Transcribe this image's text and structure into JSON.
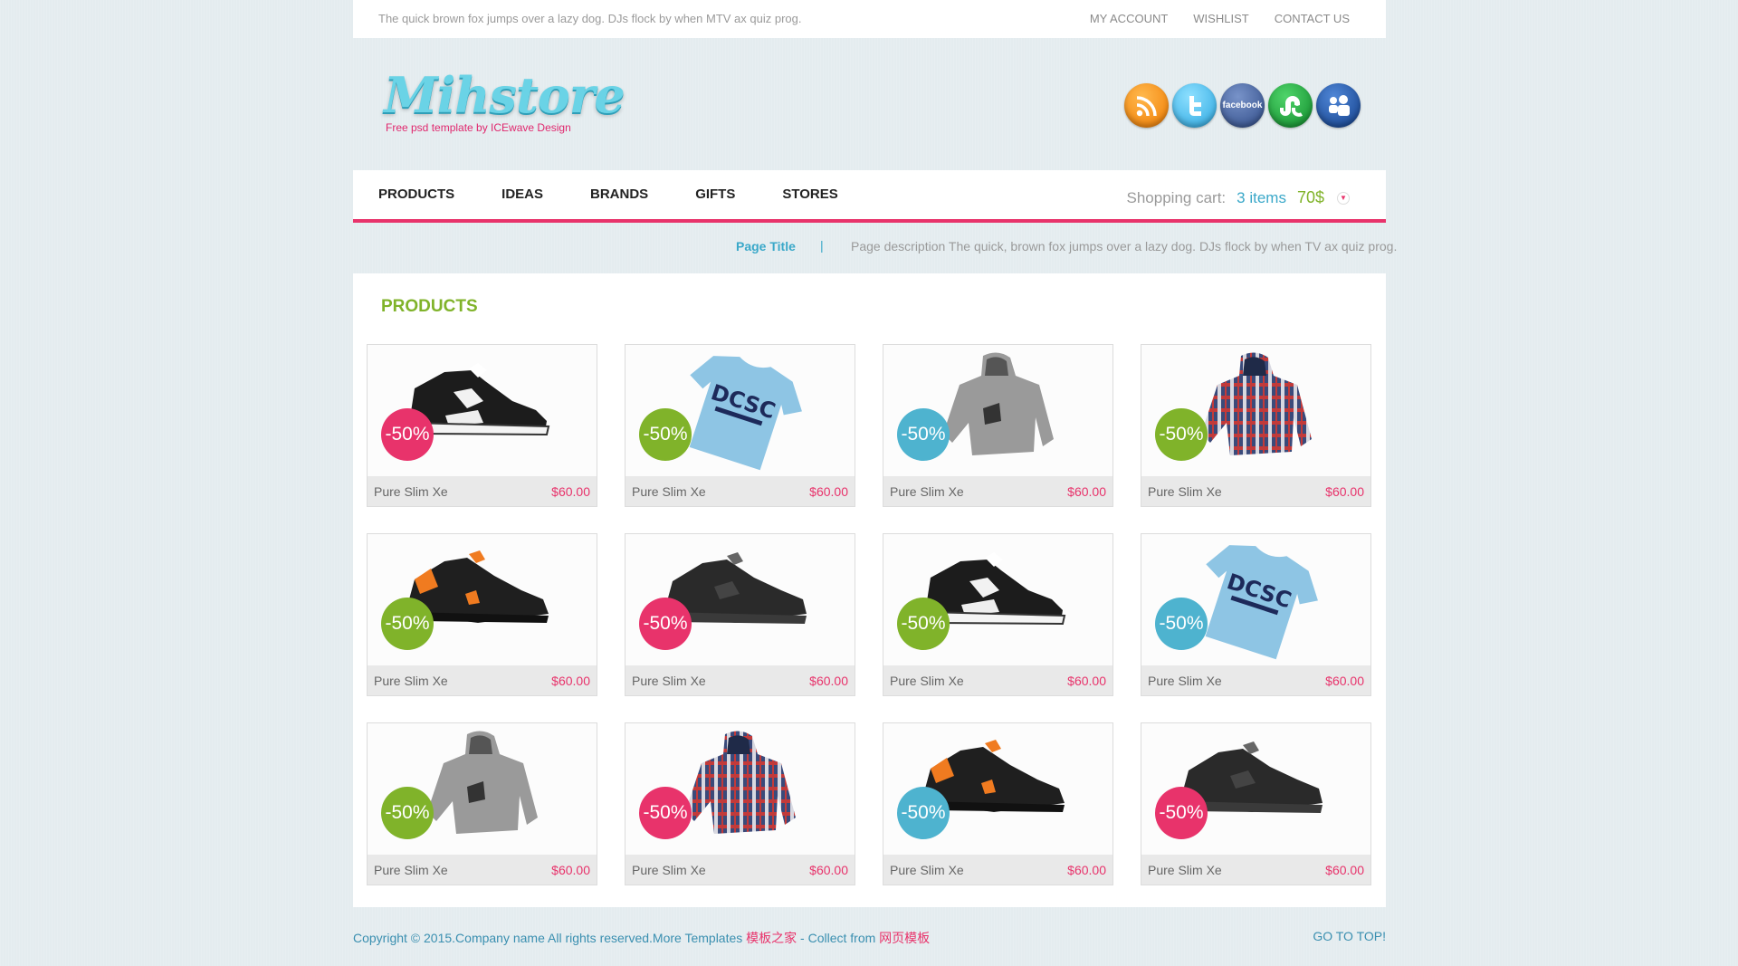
{
  "topbar": {
    "tagline": "The quick brown fox jumps over a lazy dog. DJs flock by when MTV ax quiz prog.",
    "links": [
      "MY ACCOUNT",
      "WISHLIST",
      "CONTACT US"
    ]
  },
  "header": {
    "logo_text": "Mihstore",
    "logo_sub": "Free psd template by ICEwave Design",
    "social_icons": [
      "rss-icon",
      "twitter-icon",
      "facebook-icon",
      "stumbleupon-icon",
      "myspace-icon"
    ],
    "facebook_label": "facebook"
  },
  "nav": {
    "items": [
      "PRODUCTS",
      "IDEAS",
      "BRANDS",
      "GIFTS",
      "STORES"
    ],
    "cart_label": "Shopping cart:",
    "cart_items": "3 items",
    "cart_total": "70$"
  },
  "titlebar": {
    "title": "Page Title",
    "separator": "|",
    "description": "Page description The quick, brown fox jumps over a lazy dog. DJs flock by when TV ax quiz prog."
  },
  "products": {
    "heading": "PRODUCTS",
    "items": [
      {
        "name": "Pure Slim Xe",
        "price": "$60.00",
        "discount": "-50%",
        "badge": "pink",
        "kind": "shoe-white"
      },
      {
        "name": "Pure Slim Xe",
        "price": "$60.00",
        "discount": "-50%",
        "badge": "green",
        "kind": "tshirt"
      },
      {
        "name": "Pure Slim Xe",
        "price": "$60.00",
        "discount": "-50%",
        "badge": "blue",
        "kind": "hoodie-gray"
      },
      {
        "name": "Pure Slim Xe",
        "price": "$60.00",
        "discount": "-50%",
        "badge": "green",
        "kind": "hoodie-plaid"
      },
      {
        "name": "Pure Slim Xe",
        "price": "$60.00",
        "discount": "-50%",
        "badge": "green",
        "kind": "shoe-orange"
      },
      {
        "name": "Pure Slim Xe",
        "price": "$60.00",
        "discount": "-50%",
        "badge": "pink",
        "kind": "shoe-black"
      },
      {
        "name": "Pure Slim Xe",
        "price": "$60.00",
        "discount": "-50%",
        "badge": "green",
        "kind": "shoe-white"
      },
      {
        "name": "Pure Slim Xe",
        "price": "$60.00",
        "discount": "-50%",
        "badge": "blue",
        "kind": "tshirt"
      },
      {
        "name": "Pure Slim Xe",
        "price": "$60.00",
        "discount": "-50%",
        "badge": "green",
        "kind": "hoodie-gray"
      },
      {
        "name": "Pure Slim Xe",
        "price": "$60.00",
        "discount": "-50%",
        "badge": "pink",
        "kind": "hoodie-plaid"
      },
      {
        "name": "Pure Slim Xe",
        "price": "$60.00",
        "discount": "-50%",
        "badge": "blue",
        "kind": "shoe-orange"
      },
      {
        "name": "Pure Slim Xe",
        "price": "$60.00",
        "discount": "-50%",
        "badge": "pink",
        "kind": "shoe-black"
      }
    ],
    "tshirt_print": "DCSC"
  },
  "footer": {
    "copyright": "Copyright © 2015.Company name All rights reserved.More Templates ",
    "link1": "模板之家",
    "middle": " - Collect from ",
    "link2": "网页模板",
    "go_top": "GO TO TOP!"
  },
  "colors": {
    "pink": "#e8336b",
    "green": "#80b32a",
    "blue": "#4eb3cf",
    "link": "#3aa8c9"
  }
}
